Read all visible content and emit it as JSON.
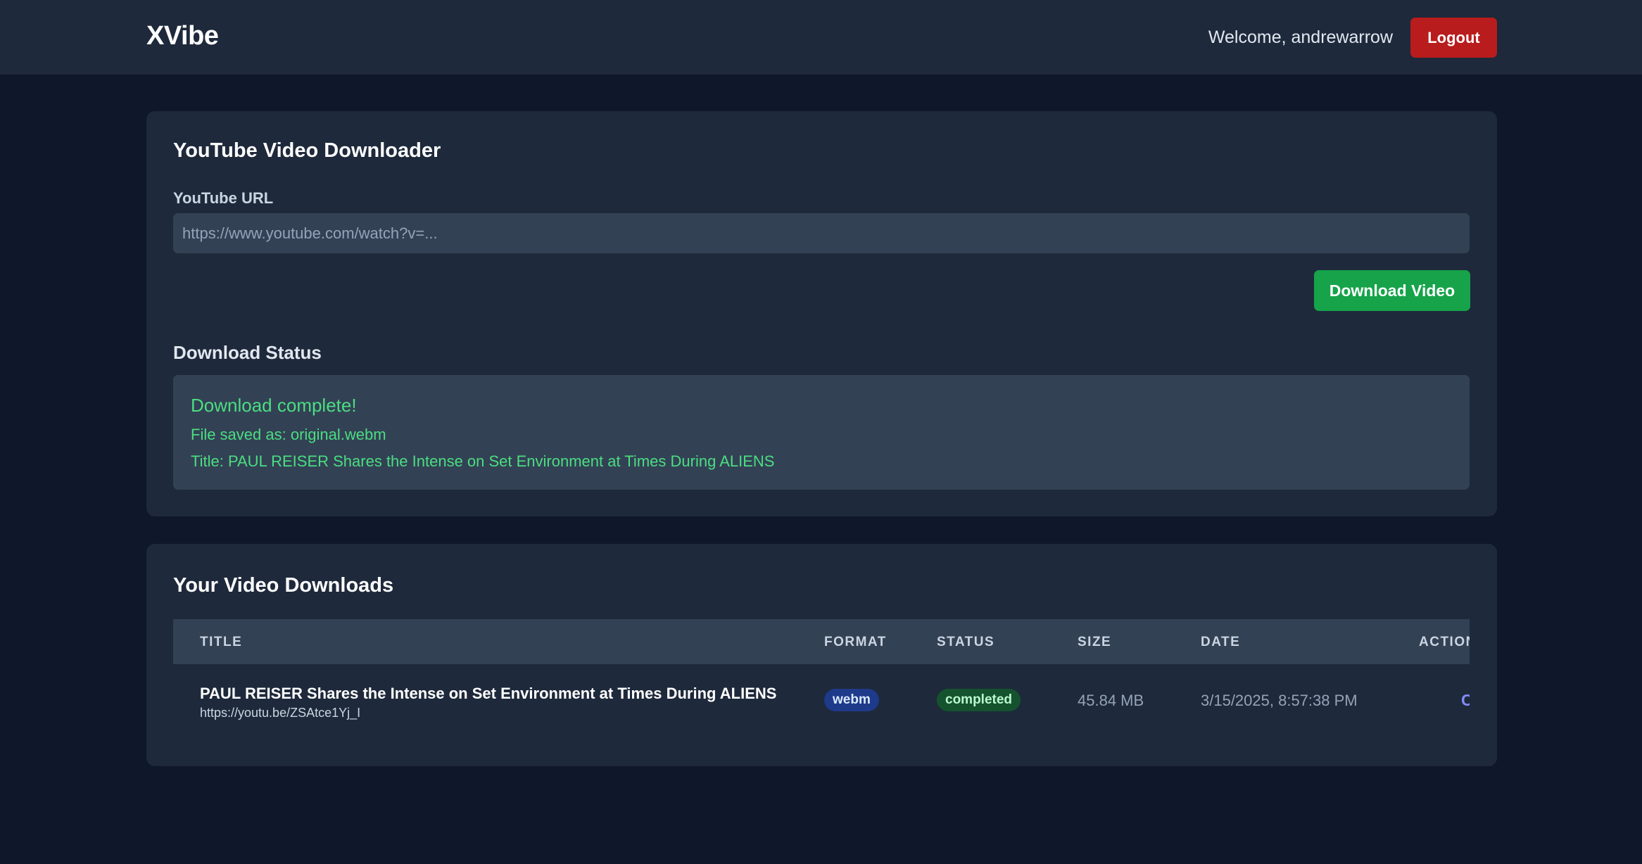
{
  "header": {
    "brand": "XVibe",
    "welcome_text": "Welcome, andrewarrow",
    "logout_label": "Logout"
  },
  "downloader": {
    "title": "YouTube Video Downloader",
    "url_label": "YouTube URL",
    "url_value": "",
    "url_placeholder": "https://www.youtube.com/watch?v=...",
    "download_button_label": "Download Video",
    "status_heading": "Download Status",
    "status": {
      "headline": "Download complete!",
      "file_line": "File saved as: original.webm",
      "title_line": "Title: PAUL REISER Shares the Intense on Set Environment at Times During ALIENS",
      "color": "#4ade80"
    }
  },
  "downloads": {
    "title": "Your Video Downloads",
    "columns": [
      "TITLE",
      "FORMAT",
      "STATUS",
      "SIZE",
      "DATE",
      "ACTIONS"
    ],
    "rows": [
      {
        "title": "PAUL REISER Shares the Intense on Set Environment at Times During ALIENS",
        "url": "https://youtu.be/ZSAtce1Yj_I",
        "format": "webm",
        "status": "completed",
        "size": "45.84 MB",
        "date": "3/15/2025, 8:57:38 PM",
        "action": "Convert"
      }
    ]
  },
  "colors": {
    "background": "#0f172a",
    "surface": "#1e293b",
    "input": "#334155",
    "primary_green": "#16a34a",
    "danger_red": "#b91c1c",
    "success_text": "#4ade80",
    "link": "#818cf8"
  }
}
